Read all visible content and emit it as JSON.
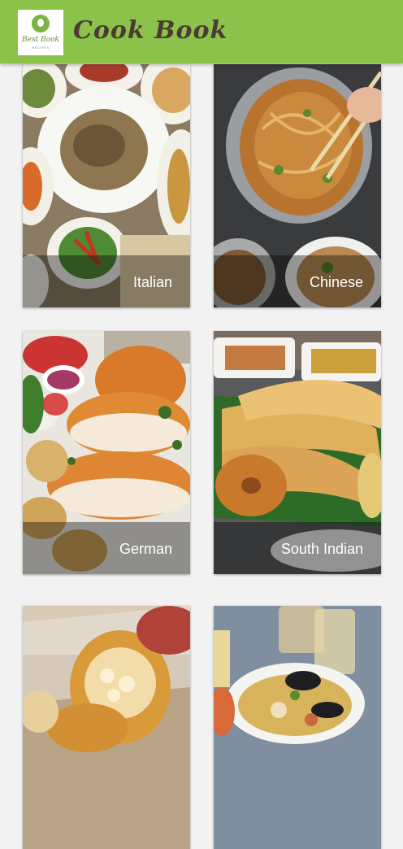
{
  "app": {
    "title": "Cook Book",
    "logo_text": "Best Book",
    "logo_subtext": "RECIPES"
  },
  "colors": {
    "appbar": "#8bc34a",
    "title": "#4a3b35",
    "background": "#f2f2f2"
  },
  "categories": [
    {
      "label": "Italian"
    },
    {
      "label": "Chinese"
    },
    {
      "label": "German"
    },
    {
      "label": "South Indian"
    },
    {
      "label": ""
    },
    {
      "label": ""
    }
  ]
}
